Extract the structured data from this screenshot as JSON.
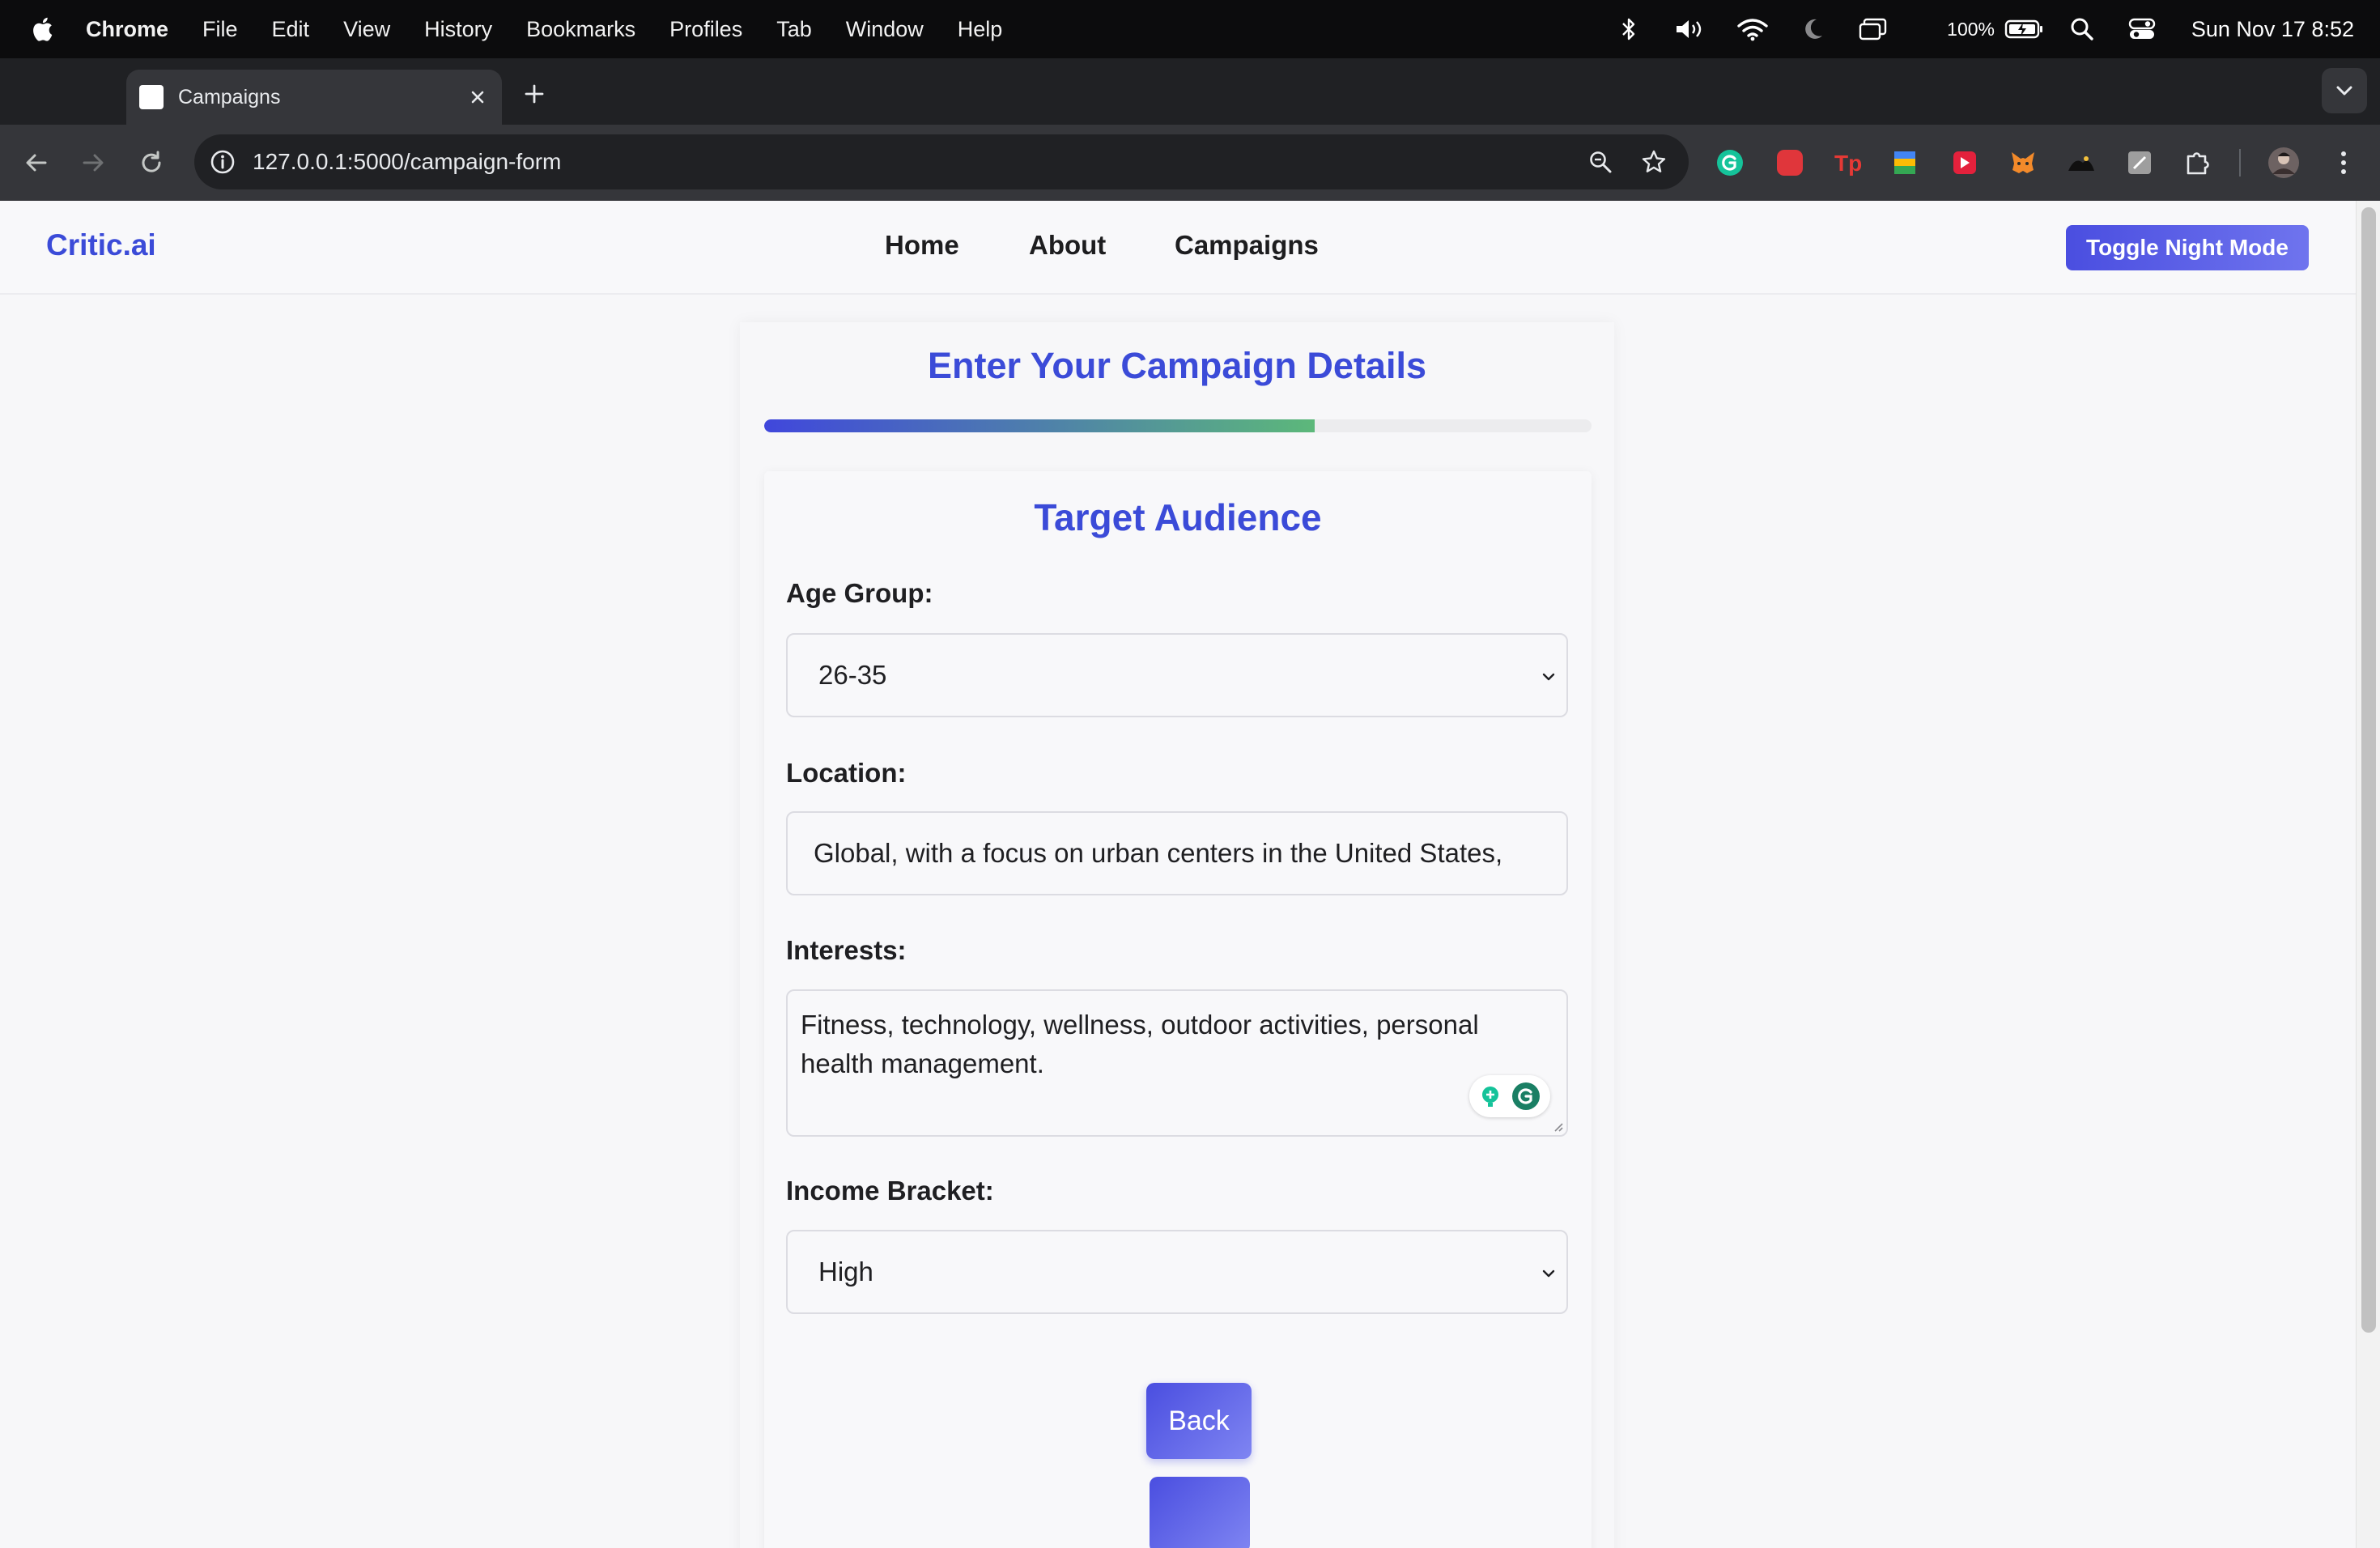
{
  "menubar": {
    "app": "Chrome",
    "items": [
      "File",
      "Edit",
      "View",
      "History",
      "Bookmarks",
      "Profiles",
      "Tab",
      "Window",
      "Help"
    ],
    "battery": "100%",
    "clock": "Sun Nov 17  8:52"
  },
  "browser": {
    "tab_title": "Campaigns",
    "url": "127.0.0.1:5000/campaign-form"
  },
  "site": {
    "brand": "Critic.ai",
    "nav": {
      "home": "Home",
      "about": "About",
      "campaigns": "Campaigns"
    },
    "toggle_night_mode": "Toggle Night Mode"
  },
  "form": {
    "title": "Enter Your Campaign Details",
    "progress_fraction": 0.665,
    "section_title": "Target Audience",
    "age_group": {
      "label": "Age Group:",
      "value": "26-35"
    },
    "location": {
      "label": "Location:",
      "value": "Global, with a focus on urban centers in the United States,"
    },
    "interests": {
      "label": "Interests:",
      "value": "Fitness, technology, wellness, outdoor activities, personal health management."
    },
    "income_bracket": {
      "label": "Income Bracket:",
      "value": "High"
    },
    "back_button": "Back"
  },
  "colors": {
    "accent": "#3b4bd8",
    "button": "#4a4ee0",
    "progress_start": "#4047dc",
    "progress_end": "#5cb87a"
  },
  "icons": {
    "menubar_status": [
      "bluetooth-icon",
      "volume-icon",
      "wifi-icon",
      "focus-moon-icon",
      "screen-mirroring-icon",
      "battery-icon",
      "spotlight-search-icon",
      "control-center-icon"
    ],
    "extensions": [
      "grammarly-extension-icon",
      "red-extension-icon",
      "tp-extension-icon",
      "color-extension-icon",
      "red-play-extension-icon",
      "metamask-extension-icon",
      "dark-extension-icon",
      "gray-extension-icon",
      "puzzle-extensions-icon"
    ]
  }
}
